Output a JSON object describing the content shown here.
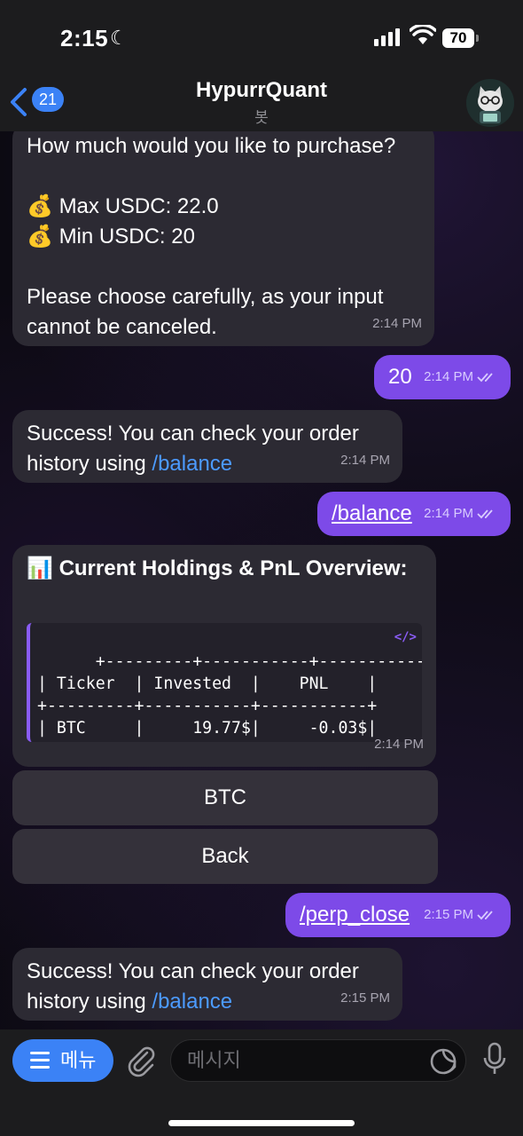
{
  "status_bar": {
    "time": "2:15",
    "battery": "70"
  },
  "header": {
    "back_count": "21",
    "title": "HypurrQuant",
    "subtitle": "봇"
  },
  "messages": {
    "m1": {
      "line1": "How much would you like to purchase?",
      "max_icon": "💰",
      "max": "Max USDC: 22.0",
      "min_icon": "💰",
      "min": "Min USDC: 20",
      "line2": "Please choose carefully, as your input",
      "line3": "cannot be canceled.",
      "time": "2:14 PM"
    },
    "m2": {
      "text": "20",
      "time": "2:14 PM"
    },
    "m3": {
      "line1": "Success! You can check your order",
      "line2_prefix": "history using ",
      "link": "/balance",
      "time": "2:14 PM"
    },
    "m4": {
      "text": "/balance",
      "time": "2:14 PM"
    },
    "m5": {
      "icon": "📊",
      "title": "Current Holdings & PnL Overview:",
      "table_text": "+---------+-----------+-----------+\n| Ticker  | Invested  |    PNL    |\n+---------+-----------+-----------+\n| BTC     |     19.77$|     -0.03$|\n+---------+-----------+-----------+",
      "time": "2:14 PM"
    },
    "kbd": {
      "btc": "BTC",
      "back": "Back"
    },
    "m6": {
      "text": "/perp_close",
      "time": "2:15 PM"
    },
    "m7": {
      "line1": "Success! You can check your order",
      "line2_prefix": "history using ",
      "link": "/balance",
      "time": "2:15 PM"
    }
  },
  "input_bar": {
    "menu_label": "메뉴",
    "placeholder": "메시지"
  },
  "colors": {
    "outgoing": "#7d4ae8",
    "incoming": "#2c2a33",
    "link": "#4c9bff",
    "accent": "#3b82f6"
  }
}
